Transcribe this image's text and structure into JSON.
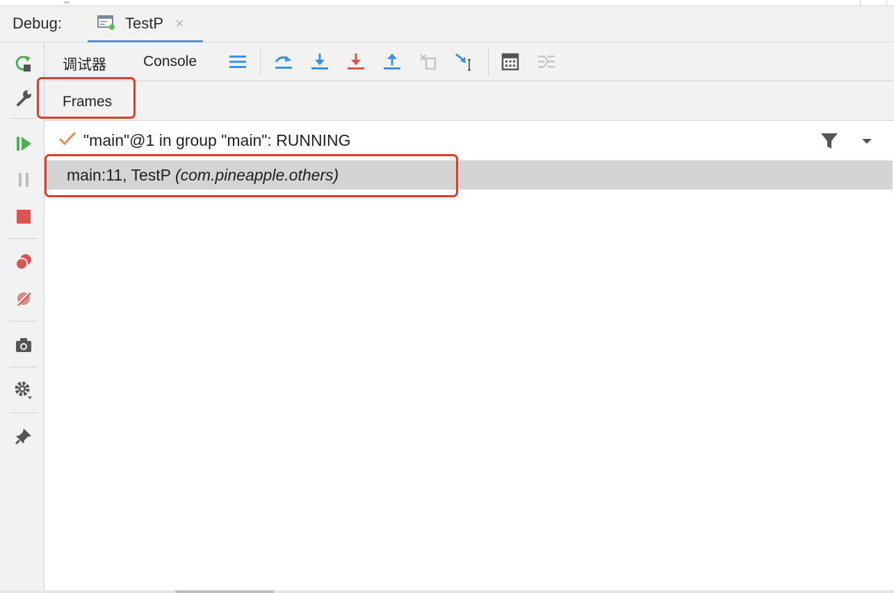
{
  "debug_header": {
    "label": "Debug:",
    "tab_title": "TestP",
    "close_glyph": "×"
  },
  "left_toolbar": {
    "icons": [
      "rerun-icon",
      "settings-wrench-icon",
      "resume-icon",
      "pause-icon",
      "stop-icon",
      "view-breakpoints-icon",
      "mute-breakpoints-icon",
      "camera-icon",
      "gear-icon",
      "pin-icon"
    ]
  },
  "toolbar": {
    "debugger_tab": "调试器",
    "console_tab": "Console",
    "icons": [
      "frames-menu-icon",
      "step-over-icon",
      "step-into-icon",
      "force-step-into-icon",
      "step-out-icon",
      "drop-frame-icon",
      "run-to-cursor-icon",
      "evaluate-expression-icon",
      "trace-icon"
    ]
  },
  "frames_panel": {
    "title": "Frames",
    "thread_text": "\"main\"@1 in group \"main\": RUNNING",
    "frame_method": "main:11, TestP ",
    "frame_package": "(com.pineapple.others)"
  },
  "colors": {
    "accent_blue": "#3d8fe0",
    "step_red": "#d9534f",
    "resume_green": "#4caf50",
    "stop_red": "#d95555",
    "highlight_box": "#e03a2a",
    "selected_row": "#d4d4d4",
    "check_orange": "#e48a55"
  }
}
